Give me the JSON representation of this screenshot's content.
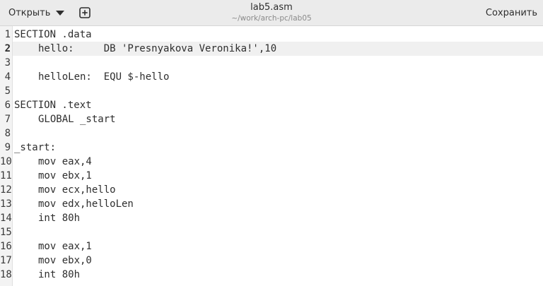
{
  "header": {
    "open_label": "Открыть",
    "title": "lab5.asm",
    "subtitle": "~/work/arch-pc/lab05",
    "save_label": "Сохранить"
  },
  "editor": {
    "current_line": 2,
    "lines": [
      {
        "n": "1",
        "indent": false,
        "text": "SECTION .data"
      },
      {
        "n": "2",
        "indent": true,
        "text": "hello:     DB 'Presnyakova Veronika!',10"
      },
      {
        "n": "3",
        "indent": false,
        "text": ""
      },
      {
        "n": "4",
        "indent": true,
        "text": "helloLen:  EQU $-hello"
      },
      {
        "n": "5",
        "indent": false,
        "text": ""
      },
      {
        "n": "6",
        "indent": false,
        "text": "SECTION .text"
      },
      {
        "n": "7",
        "indent": true,
        "text": "GLOBAL _start"
      },
      {
        "n": "8",
        "indent": false,
        "text": ""
      },
      {
        "n": "9",
        "indent": false,
        "text": "_start:"
      },
      {
        "n": "10",
        "indent": true,
        "text": "mov eax,4"
      },
      {
        "n": "11",
        "indent": true,
        "text": "mov ebx,1"
      },
      {
        "n": "12",
        "indent": true,
        "text": "mov ecx,hello"
      },
      {
        "n": "13",
        "indent": true,
        "text": "mov edx,helloLen"
      },
      {
        "n": "14",
        "indent": true,
        "text": "int 80h"
      },
      {
        "n": "15",
        "indent": false,
        "text": ""
      },
      {
        "n": "16",
        "indent": true,
        "text": "mov eax,1"
      },
      {
        "n": "17",
        "indent": true,
        "text": "mov ebx,0"
      },
      {
        "n": "18",
        "indent": true,
        "text": "int 80h"
      }
    ]
  }
}
